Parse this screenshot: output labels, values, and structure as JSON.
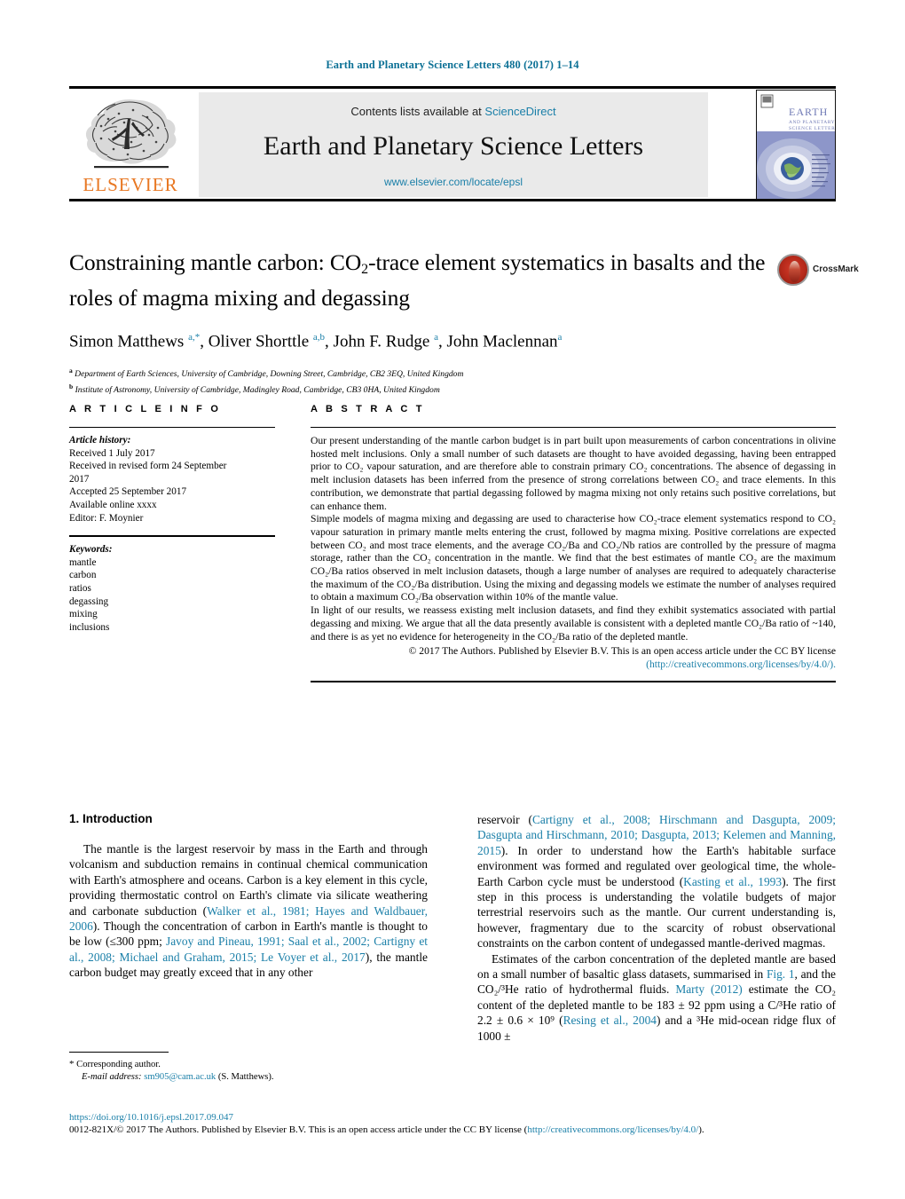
{
  "running_head": "Earth and Planetary Science Letters 480 (2017) 1–14",
  "masthead": {
    "contents_prefix": "Contents lists available at",
    "contents_link": "ScienceDirect",
    "journal_title": "Earth and Planetary Science Letters",
    "journal_url": "www.elsevier.com/locate/epsl",
    "publisher_name": "ELSEVIER",
    "cover_title_line1": "EARTH",
    "cover_title_line2": "AND PLANETARY",
    "cover_title_line3": "SCIENCE LETTERS"
  },
  "article": {
    "title_line1": "Constraining mantle carbon: CO",
    "title_sub": "2",
    "title_line1b": "-trace element systematics in basalts",
    "title_line2": "and the roles of magma mixing and degassing",
    "authors": "Simon Matthews ᵃ,*, Oliver Shorttle ᵃ,ᵇ, John F. Rudge ᵃ, John Maclennan ᵃ",
    "affiliation_a": "Department of Earth Sciences, University of Cambridge, Downing Street, Cambridge, CB2 3EQ, United Kingdom",
    "affiliation_b": "Institute of Astronomy, University of Cambridge, Madingley Road, Cambridge, CB3 0HA, United Kingdom",
    "crossmark_label": "CrossMark"
  },
  "article_info": {
    "heading": "A R T I C L E   I N F O",
    "history_label": "Article history:",
    "history": [
      "Received 1 July 2017",
      "Received in revised form 24 September",
      "2017",
      "Accepted 25 September 2017",
      "Available online xxxx",
      "Editor: F. Moynier"
    ],
    "keywords_label": "Keywords:",
    "keywords": [
      "mantle",
      "carbon",
      "ratios",
      "degassing",
      "mixing",
      "inclusions"
    ]
  },
  "abstract": {
    "heading": "A B S T R A C T",
    "para1": "Our present understanding of the mantle carbon budget is in part built upon measurements of carbon concentrations in olivine hosted melt inclusions. Only a small number of such datasets are thought to have avoided degassing, having been entrapped prior to CO₂ vapour saturation, and are therefore able to constrain primary CO₂ concentrations. The absence of degassing in melt inclusion datasets has been inferred from the presence of strong correlations between CO₂ and trace elements. In this contribution, we demonstrate that partial degassing followed by magma mixing not only retains such positive correlations, but can enhance them.",
    "para2": "Simple models of magma mixing and degassing are used to characterise how CO₂-trace element systematics respond to CO₂ vapour saturation in primary mantle melts entering the crust, followed by magma mixing. Positive correlations are expected between CO₂ and most trace elements, and the average CO₂/Ba and CO₂/Nb ratios are controlled by the pressure of magma storage, rather than the CO₂ concentration in the mantle. We find that the best estimates of mantle CO₂ are the maximum CO₂/Ba ratios observed in melt inclusion datasets, though a large number of analyses are required to adequately characterise the maximum of the CO₂/Ba distribution. Using the mixing and degassing models we estimate the number of analyses required to obtain a maximum CO₂/Ba observation within 10% of the mantle value.",
    "para3": "In light of our results, we reassess existing melt inclusion datasets, and find they exhibit systematics associated with partial degassing and mixing. We argue that all the data presently available is consistent with a depleted mantle CO₂/Ba ratio of ~140, and there is as yet no evidence for heterogeneity in the CO₂/Ba ratio of the depleted mantle.",
    "copyright_text": "© 2017 The Authors. Published by Elsevier B.V. This is an open access article under the CC BY license",
    "license_url": "(http://creativecommons.org/licenses/by/4.0/)."
  },
  "body": {
    "section_heading": "1. Introduction",
    "left_para1_a": "The mantle is the largest reservoir by mass in the Earth and through volcanism and subduction remains in continual chemical communication with Earth's atmosphere and oceans. Carbon is a key element in this cycle, providing thermostatic control on Earth's climate via silicate weathering and carbonate subduction (",
    "left_ref1": "Walker et al., 1981; Hayes and Waldbauer, 2006",
    "left_para1_b": "). Though the concentration of carbon in Earth's mantle is thought to be low (≤300 ppm; ",
    "left_ref2": "Javoy and Pineau, 1991; Saal et al., 2002; Cartigny et al., 2008; Michael and Graham, 2015; Le Voyer et al., 2017",
    "left_para1_c": "), the mantle carbon budget may greatly exceed that in any other",
    "right_para1_a": "reservoir (",
    "right_ref1": "Cartigny et al., 2008; Hirschmann and Dasgupta, 2009; Dasgupta and Hirschmann, 2010; Dasgupta, 2013; Kelemen and Manning, 2015",
    "right_para1_b": "). In order to understand how the Earth's habitable surface environment was formed and regulated over geological time, the whole-Earth Carbon cycle must be understood (",
    "right_ref2": "Kasting et al., 1993",
    "right_para1_c": "). The first step in this process is understanding the volatile budgets of major terrestrial reservoirs such as the mantle. Our current understanding is, however, fragmentary due to the scarcity of robust observational constraints on the carbon content of undegassed mantle-derived magmas.",
    "right_para2_a": "Estimates of the carbon concentration of the depleted mantle are based on a small number of basaltic glass datasets, summarised in ",
    "right_ref3": "Fig. 1",
    "right_para2_b": ", and the CO₂/³He ratio of hydrothermal fluids. ",
    "right_ref4": "Marty (2012)",
    "right_para2_c": " estimate the CO₂ content of the depleted mantle to be 183 ± 92 ppm using a C/³He ratio of 2.2 ± 0.6 × 10⁹ (",
    "right_ref5": "Resing et al., 2004",
    "right_para2_d": ") and a ³He mid-ocean ridge flux of 1000 ±"
  },
  "footnote": {
    "star": "*",
    "corresponding": "Corresponding author.",
    "email_label": "E-mail address:",
    "email": "sm905@cam.ac.uk",
    "email_suffix": "(S. Matthews)."
  },
  "page_footer": {
    "doi": "https://doi.org/10.1016/j.epsl.2017.09.047",
    "issn_prefix": "0012-821X/© 2017 The Authors. Published by Elsevier B.V. This is an open access article under the CC BY license (",
    "issn_link": "http://creativecommons.org/licenses/by/4.0/",
    "issn_suffix": ")."
  },
  "colors": {
    "link": "#1a7fa8",
    "runhead": "#0b7095",
    "elsevier_orange": "#e87722",
    "mast_bg": "#eaeaea"
  }
}
